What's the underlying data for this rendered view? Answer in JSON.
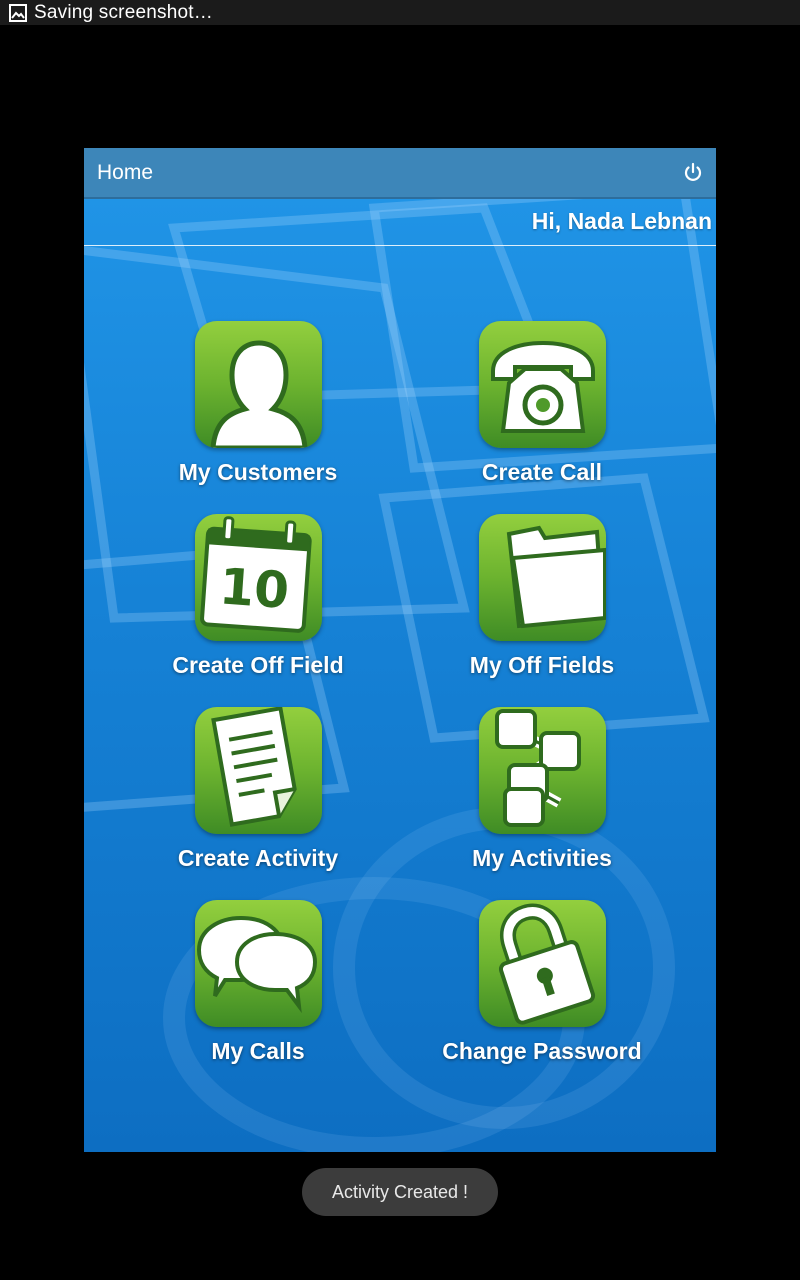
{
  "status_bar": {
    "text": "Saving screenshot…",
    "icon": "image-icon"
  },
  "app": {
    "title": "Home",
    "power_icon": "power-icon",
    "greeting": "Hi, Nada Lebnan"
  },
  "menu": {
    "items": [
      {
        "label": "My Customers",
        "icon": "person-icon"
      },
      {
        "label": "Create Call",
        "icon": "telephone-icon"
      },
      {
        "label": "Create Off Field",
        "icon": "calendar-icon",
        "icon_text": "10"
      },
      {
        "label": "My Off Fields",
        "icon": "folder-icon"
      },
      {
        "label": "Create Activity",
        "icon": "document-icon"
      },
      {
        "label": "My Activities",
        "icon": "flowchart-icon"
      },
      {
        "label": "My Calls",
        "icon": "chat-bubbles-icon"
      },
      {
        "label": "Change Password",
        "icon": "padlock-icon"
      }
    ]
  },
  "toast": {
    "text": "Activity Created !"
  },
  "colors": {
    "title_bar": "#3d86b9",
    "background_blue": "#1a86d8",
    "tile_green": "#6cb32f",
    "toast_bg": "#3c3c3c"
  }
}
